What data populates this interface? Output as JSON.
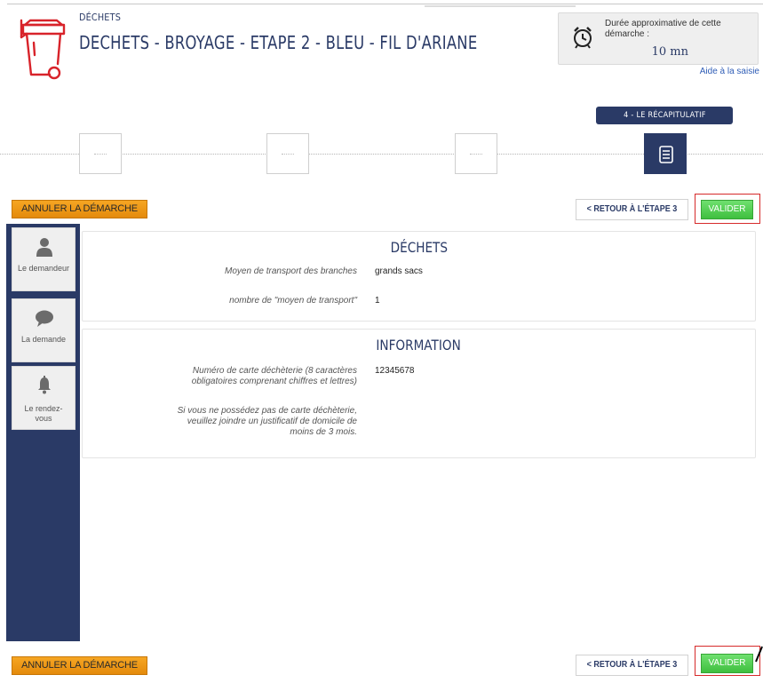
{
  "header": {
    "category": "DÉCHETS",
    "title": "DECHETS - BROYAGE - ETAPE 2 - BLEU - FIL D'ARIANE",
    "duration_label": "Durée approximative de cette démarche :",
    "duration_value": "10 mn",
    "help_link": "Aide à la saisie"
  },
  "steps": {
    "current_label": "4 - LE RÉCAPITULATIF",
    "items": [
      {
        "name": "step-1",
        "active": false
      },
      {
        "name": "step-2",
        "active": false
      },
      {
        "name": "step-3",
        "active": false
      },
      {
        "name": "step-4",
        "active": true,
        "icon": "document-icon"
      }
    ]
  },
  "actions": {
    "cancel_label": "ANNULER LA DÉMARCHE",
    "back_label": "< RETOUR À L'ÉTAPE 3",
    "validate_label": "VALIDER"
  },
  "sidebar": {
    "items": [
      {
        "label": "Le demandeur",
        "icon": "user-icon"
      },
      {
        "label": "La demande",
        "icon": "speech-bubble-icon"
      },
      {
        "label": "Le rendez-vous",
        "icon": "bell-icon"
      }
    ]
  },
  "sections": {
    "dechets": {
      "title": "DÉCHETS",
      "rows": [
        {
          "label": "Moyen de transport des branches",
          "value": "grands sacs"
        },
        {
          "label": "nombre de \"moyen de transport\"",
          "value": "1"
        }
      ]
    },
    "information": {
      "title": "INFORMATION",
      "rows": [
        {
          "label": "Numéro de carte déchèterie (8 caractères obligatoires comprenant chiffres et lettres)",
          "value": "12345678"
        },
        {
          "label": "Si vous ne possédez pas de carte déchèterie, veuillez joindre un justificatif de domicile de moins de 3 mois.",
          "value": ""
        }
      ]
    }
  },
  "colors": {
    "primary": "#2a3a66",
    "cancel": "#f6a623",
    "validate": "#4cc94c",
    "highlight_frame": "#d62a2a",
    "logo": "#d8232a"
  }
}
